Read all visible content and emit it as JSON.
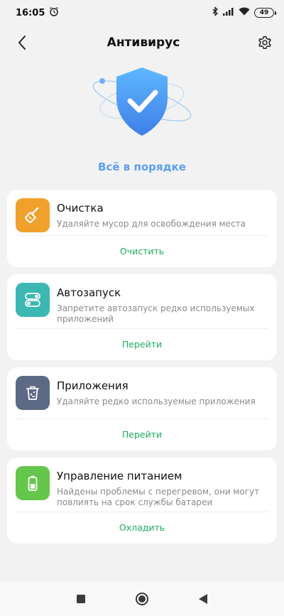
{
  "status_bar": {
    "time": "16:05",
    "battery": "49",
    "icons": [
      "alarm-icon",
      "bluetooth-icon",
      "signal-icon",
      "wifi-icon",
      "battery-icon"
    ]
  },
  "header": {
    "title": "Антивирус",
    "back_icon": "back-arrow-icon",
    "settings_icon": "gear-icon"
  },
  "hero": {
    "status": "Всё в порядке",
    "icon": "shield-check-icon"
  },
  "cards": [
    {
      "title": "Очистка",
      "description": "Удаляйте мусор для освобождения места",
      "action": "Очистить",
      "icon": "broom-icon",
      "color": "#f0a12c"
    },
    {
      "title": "Автозапуск",
      "description": "Запретите автозапуск редко используемых приложений",
      "action": "Перейти",
      "icon": "toggles-icon",
      "color": "#3cb7b2"
    },
    {
      "title": "Приложения",
      "description": "Удаляйте редко используемые приложения",
      "action": "Перейти",
      "icon": "trash-icon",
      "color": "#5c6a85"
    },
    {
      "title": "Управление питанием",
      "description": "Найдены проблемы с перегревом, они могут повлиять на срок службы батареи",
      "action": "Охладить",
      "icon": "battery-icon",
      "color": "#64c64a"
    }
  ],
  "colors": {
    "accent_green": "#1cad5d",
    "hero_blue": "#5aa0f0"
  },
  "nav_bar": {
    "icons": [
      "recent-apps-icon",
      "home-icon",
      "back-icon"
    ]
  }
}
